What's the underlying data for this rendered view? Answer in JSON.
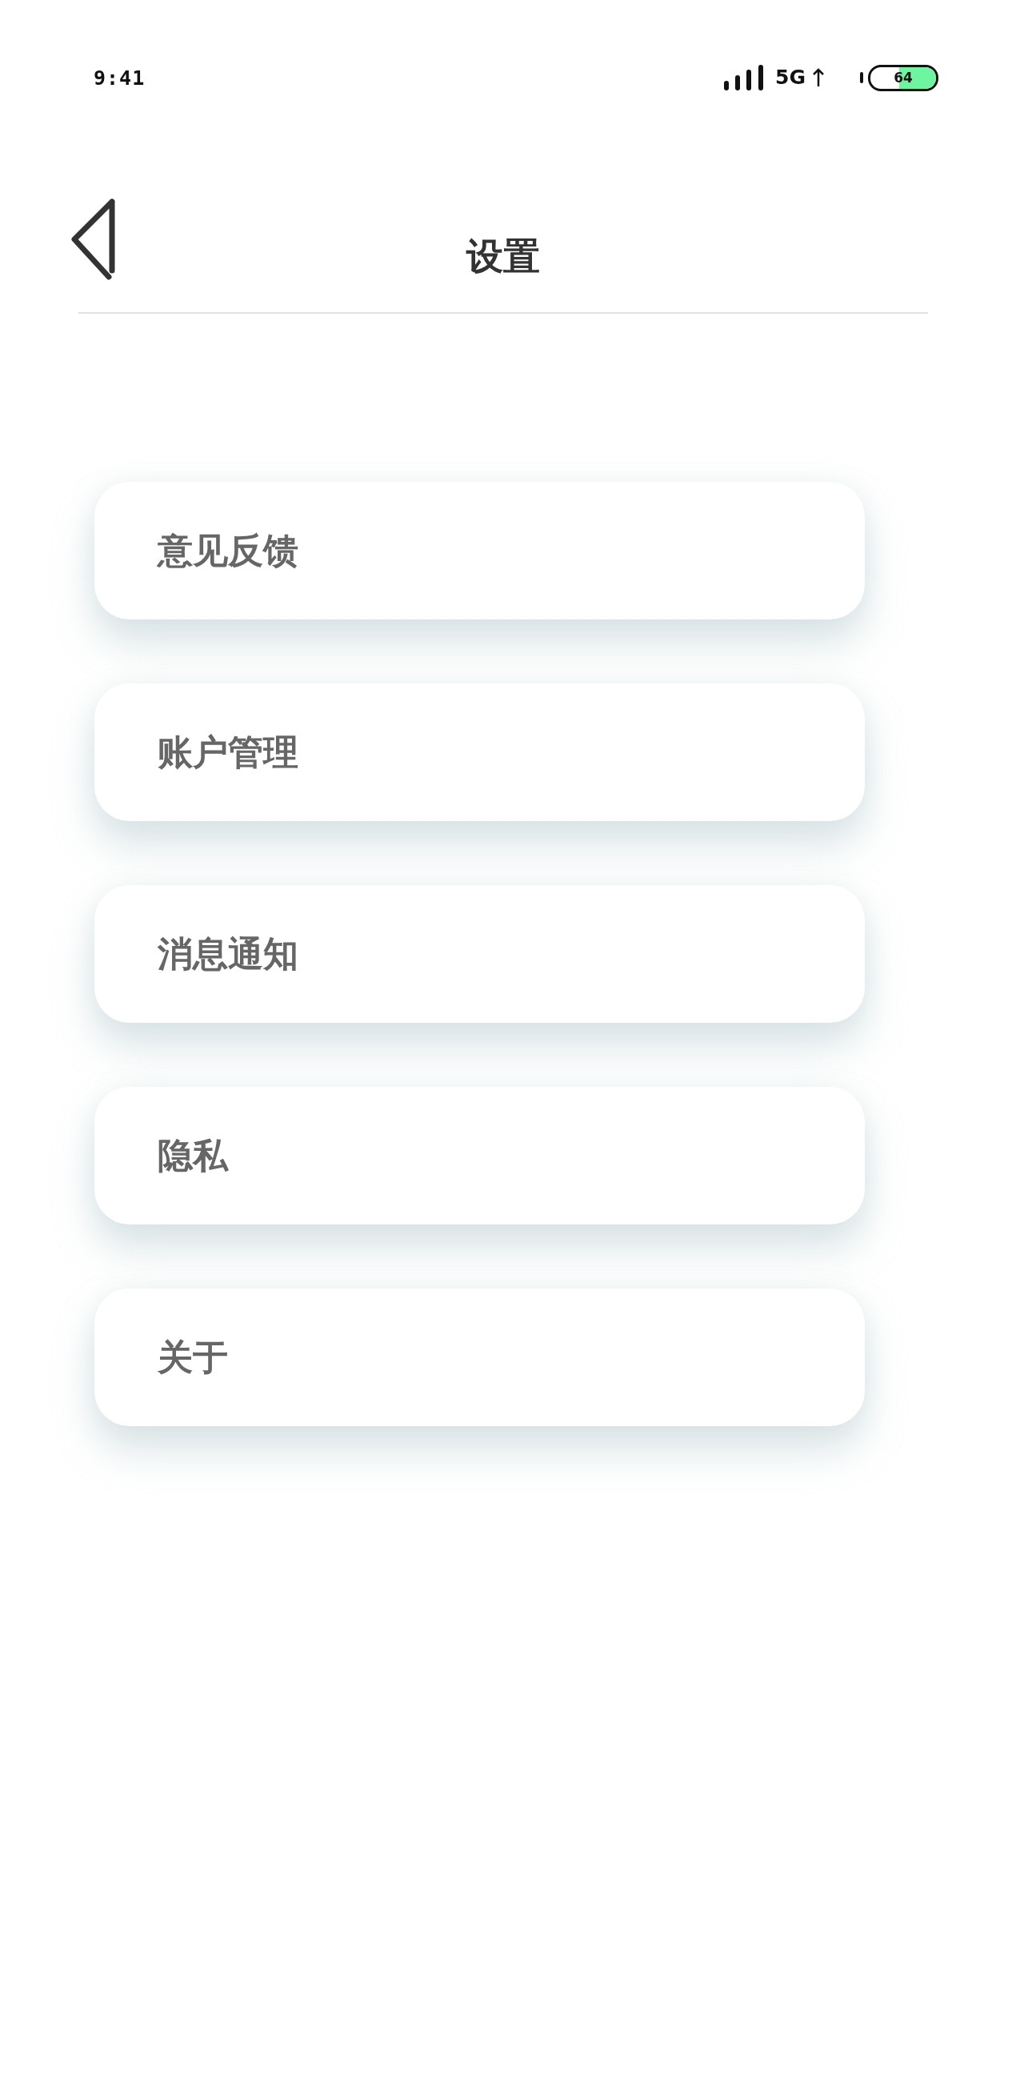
{
  "status_bar": {
    "time": "9:41",
    "network": "5G",
    "battery": "64"
  },
  "header": {
    "title": "设置"
  },
  "menu": [
    {
      "label": "意见反馈"
    },
    {
      "label": "账户管理"
    },
    {
      "label": "消息通知"
    },
    {
      "label": "隐私"
    },
    {
      "label": "关于"
    }
  ]
}
